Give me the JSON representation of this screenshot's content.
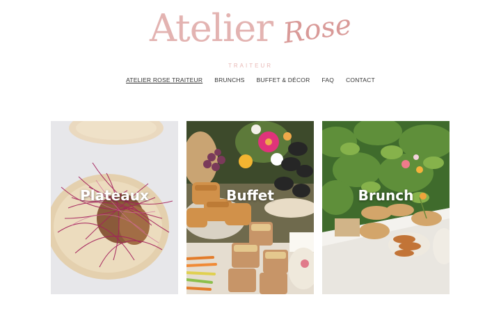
{
  "brand": {
    "name_main": "Atelier",
    "name_script": "Rose",
    "tagline": "TRAITEUR",
    "colors": {
      "primary": "#e3b3b1",
      "script": "#d99a98"
    }
  },
  "nav": {
    "items": [
      {
        "label": "ATELIER ROSE TRAITEUR",
        "active": true
      },
      {
        "label": "BRUNCHS",
        "active": false
      },
      {
        "label": "BUFFET & DÉCOR",
        "active": false
      },
      {
        "label": "FAQ",
        "active": false
      },
      {
        "label": "CONTACT",
        "active": false
      }
    ]
  },
  "cards": [
    {
      "title": "Plateaux",
      "image": "tortilla-with-red-sprouts-photo"
    },
    {
      "title": "Buffet",
      "image": "buffet-table-with-flowers-photo"
    },
    {
      "title": "Brunch",
      "image": "outdoor-brunch-table-photo"
    }
  ]
}
